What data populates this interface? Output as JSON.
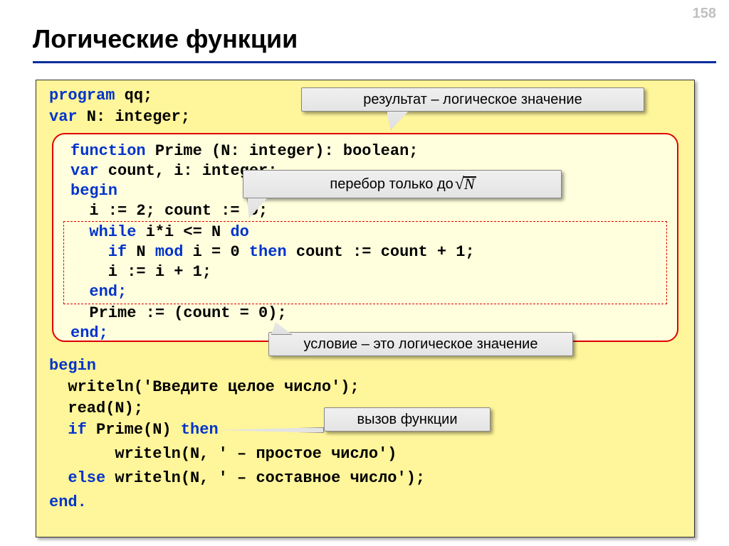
{
  "page_number": "158",
  "title": "Логические функции",
  "callouts": {
    "result": "результат – логическое значение",
    "iterate": "перебор только до ",
    "sqrt_var": "N",
    "condition": "условие – это логическое значение",
    "call": "вызов функции"
  },
  "code": {
    "l1a": "program",
    "l1b": " qq;",
    "l2a": "var",
    "l2b": " N: integer;",
    "l3a": "function",
    "l3b": " Prime (N: integer): boolean;",
    "l4a": "var",
    "l4b": " count, i: integer;",
    "l5": "begin",
    "l6": "  i := 2; count := 0;",
    "l7a": "  while",
    "l7b": " i*i <= N ",
    "l7c": "do",
    "l8a": "    if",
    "l8b": " N ",
    "l8c": "mod",
    "l8d": " i = 0 ",
    "l8e": "then",
    "l8f": " count := count + 1;",
    "l9": "    i := i + 1;",
    "l10": "  end;",
    "l11": "  Prime := (count = 0);",
    "l12": "end;",
    "l13": "begin",
    "l14": "  writeln('Введите целое число');",
    "l15": "  read(N);",
    "l16a": "  if",
    "l16b": " Prime(N) ",
    "l16c": "then",
    "l17": "       writeln(N, ' – простое число')",
    "l18a": "  else",
    "l18b": " writeln(N, ' – составное число');",
    "l19": "end."
  }
}
